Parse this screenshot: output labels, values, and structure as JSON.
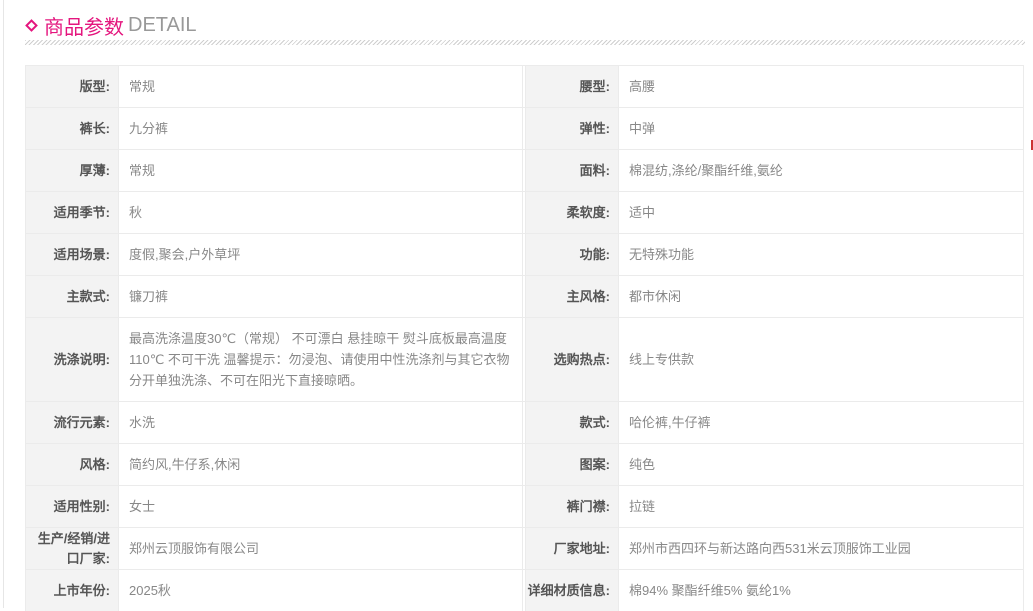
{
  "header": {
    "title_cn": "商品参数",
    "title_en": "DETAIL"
  },
  "rows": [
    [
      {
        "label": "版型:",
        "value": "常规"
      },
      {
        "label": "腰型:",
        "value": "高腰"
      }
    ],
    [
      {
        "label": "裤长:",
        "value": "九分裤"
      },
      {
        "label": "弹性:",
        "value": "中弹"
      }
    ],
    [
      {
        "label": "厚薄:",
        "value": "常规"
      },
      {
        "label": "面料:",
        "value": "棉混纺,涤纶/聚酯纤维,氨纶"
      }
    ],
    [
      {
        "label": "适用季节:",
        "value": "秋"
      },
      {
        "label": "柔软度:",
        "value": "适中"
      }
    ],
    [
      {
        "label": "适用场景:",
        "value": "度假,聚会,户外草坪"
      },
      {
        "label": "功能:",
        "value": "无特殊功能"
      }
    ],
    [
      {
        "label": "主款式:",
        "value": "镰刀裤"
      },
      {
        "label": "主风格:",
        "value": "都市休闲"
      }
    ],
    [
      {
        "label": "洗涤说明:",
        "value": "最高洗涤温度30℃（常规） 不可漂白 悬挂晾干 熨斗底板最高温度110℃ 不可干洗 温馨提示：勿浸泡、请使用中性洗涤剂与其它衣物分开单独洗涤、不可在阳光下直接晾晒。"
      },
      {
        "label": "选购热点:",
        "value": "线上专供款"
      }
    ],
    [
      {
        "label": "流行元素:",
        "value": "水洗"
      },
      {
        "label": "款式:",
        "value": "哈伦裤,牛仔裤"
      }
    ],
    [
      {
        "label": "风格:",
        "value": "简约风,牛仔系,休闲"
      },
      {
        "label": "图案:",
        "value": "纯色"
      }
    ],
    [
      {
        "label": "适用性别:",
        "value": "女士"
      },
      {
        "label": "裤门襟:",
        "value": "拉链"
      }
    ],
    [
      {
        "label": "生产/经销/进口厂家:",
        "value": "郑州云顶服饰有限公司"
      },
      {
        "label": "厂家地址:",
        "value": "郑州市西四环与新达路向西531米云顶服饰工业园"
      }
    ],
    [
      {
        "label": "上市年份:",
        "value": "2025秋"
      },
      {
        "label": "详细材质信息:",
        "value": "棉94% 聚酯纤维5% 氨纶1%"
      }
    ]
  ]
}
